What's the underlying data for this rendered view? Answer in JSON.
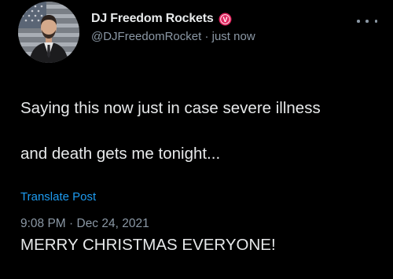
{
  "user": {
    "display_name": "DJ Freedom Rockets",
    "handle": "@DJFreedomRocket",
    "separator": " · ",
    "time_ago": "just now",
    "badge_letter": "V",
    "badge_color": "#e0245e"
  },
  "post": {
    "lines": [
      "Saying this now just in case severe illness",
      "and death gets me tonight...",
      "",
      "MERRY CHRISTMAS EVERYONE!"
    ],
    "translate_label": "Translate Post",
    "timestamp": "9:08 PM · Dec 24, 2021"
  },
  "theme": {
    "background": "#000000",
    "text": "#e7e9ea",
    "muted": "#8b98a5",
    "link": "#1d9bf0"
  },
  "icons": {
    "more": "more-dots-icon",
    "badge": "verified-badge-icon",
    "avatar": "profile-avatar"
  }
}
